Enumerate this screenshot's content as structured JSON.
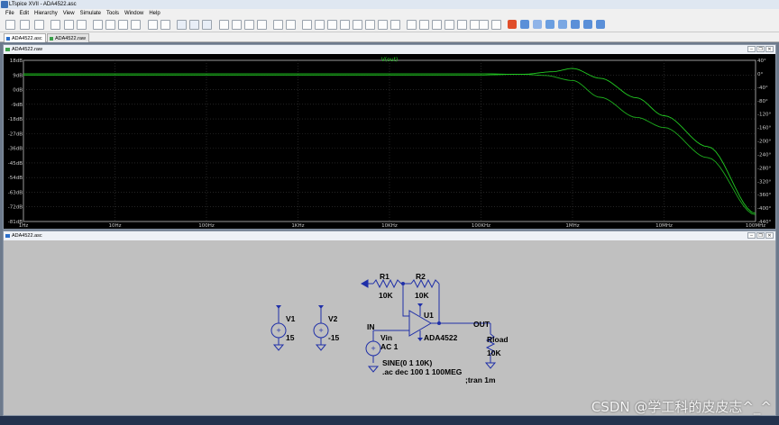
{
  "window": {
    "title": "LTspice XVII - ADA4522.asc"
  },
  "menu": [
    "File",
    "Edit",
    "Hierarchy",
    "View",
    "Simulate",
    "Tools",
    "Window",
    "Help"
  ],
  "tabs": [
    {
      "label": "ADA4522.asc",
      "active": true
    },
    {
      "label": "ADA4522.raw",
      "active": false
    }
  ],
  "waveform_window": {
    "title": "ADA4522.raw",
    "trace_label": "V(out)",
    "left_axis_labels": [
      "18dB",
      "9dB",
      "0dB",
      "-9dB",
      "-18dB",
      "-27dB",
      "-36dB",
      "-45dB",
      "-54dB",
      "-63dB",
      "-72dB",
      "-81dB"
    ],
    "right_axis_labels": [
      "40°",
      "0°",
      "-40°",
      "-80°",
      "-120°",
      "-160°",
      "-200°",
      "-240°",
      "-280°",
      "-320°",
      "-360°",
      "-400°",
      "-440°"
    ],
    "x_axis_labels": [
      "1Hz",
      "10Hz",
      "100Hz",
      "1KHz",
      "10KHz",
      "100KHz",
      "1MHz",
      "10MHz",
      "100MHz"
    ],
    "colors": {
      "background": "#000000",
      "trace": "#22cc22",
      "grid": "#3a3a3a"
    }
  },
  "chart_data": {
    "type": "line",
    "title": "V(out)",
    "x_scale": "log",
    "x_range": [
      1,
      100000000
    ],
    "y_range_left": [
      -81,
      18
    ],
    "y_range_right": [
      -440,
      40
    ],
    "series": [
      {
        "name": "V(out)",
        "axis": "left",
        "x": [
          1,
          10,
          100,
          1000,
          10000,
          100000,
          300000,
          600000,
          1000000,
          2000000,
          5000000,
          10000000,
          30000000,
          100000000
        ],
        "y": [
          9,
          9,
          9,
          9,
          9,
          9,
          9.5,
          11,
          13,
          7,
          -5,
          -16,
          -35,
          -76
        ]
      },
      {
        "axis": "right",
        "x": [
          1,
          10,
          100,
          1000,
          10000,
          100000,
          300000,
          500000,
          1000000,
          2000000,
          5000000,
          10000000,
          30000000,
          100000000
        ],
        "y": [
          0,
          0,
          0,
          0,
          0,
          0,
          -2,
          -5,
          -20,
          -70,
          -130,
          -160,
          -250,
          -420
        ]
      }
    ]
  },
  "schematic_window": {
    "title": "ADA4522.asc",
    "labels": {
      "R1": "R1",
      "R1_val": "10K",
      "R2": "R2",
      "R2_val": "10K",
      "U1": "U1",
      "U1_part": "ADA4522",
      "V1": "V1",
      "V1_val": "15",
      "V2": "V2",
      "V2_val": "-15",
      "IN": "IN",
      "Vin": "Vin",
      "Vin_ac": "AC 1",
      "Vin_sine": "SINE(0 1 10K)",
      "ac_cmd": ".ac dec 100 1 100MEG",
      "OUT": "OUT",
      "Rload": "Rload",
      "Rload_val": "10K",
      "tran_cmd": ";tran 1m"
    }
  },
  "watermark": "CSDN @学工科的皮皮志^_^"
}
